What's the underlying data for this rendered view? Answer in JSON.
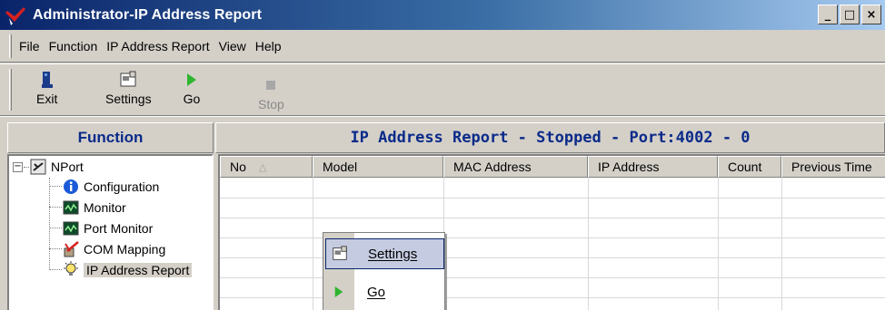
{
  "window": {
    "title": "Administrator-IP Address Report",
    "buttons": [
      "_",
      "□",
      "×"
    ]
  },
  "menu": [
    "File",
    "Function",
    "IP Address Report",
    "View",
    "Help"
  ],
  "toolbar": {
    "exit": "Exit",
    "settings": "Settings",
    "go": "Go",
    "stop": "Stop"
  },
  "left_panel": {
    "header": "Function",
    "tree": {
      "root": "NPort",
      "children": [
        "Configuration",
        "Monitor",
        "Port Monitor",
        "COM Mapping",
        "IP Address Report"
      ],
      "selected": "IP Address Report"
    }
  },
  "right_panel": {
    "header": "IP Address Report - Stopped - Port:4002 - 0",
    "columns": [
      "No",
      "Model",
      "MAC Address",
      "IP Address",
      "Count",
      "Previous Time"
    ],
    "sort_indicator": "△"
  },
  "context_menu": {
    "items": [
      "Settings",
      "Go"
    ]
  },
  "colors": {
    "title_start": "#0a246a",
    "title_end": "#a6caf0",
    "header_text": "#0a2a8a",
    "go_green": "#2fb52f"
  }
}
